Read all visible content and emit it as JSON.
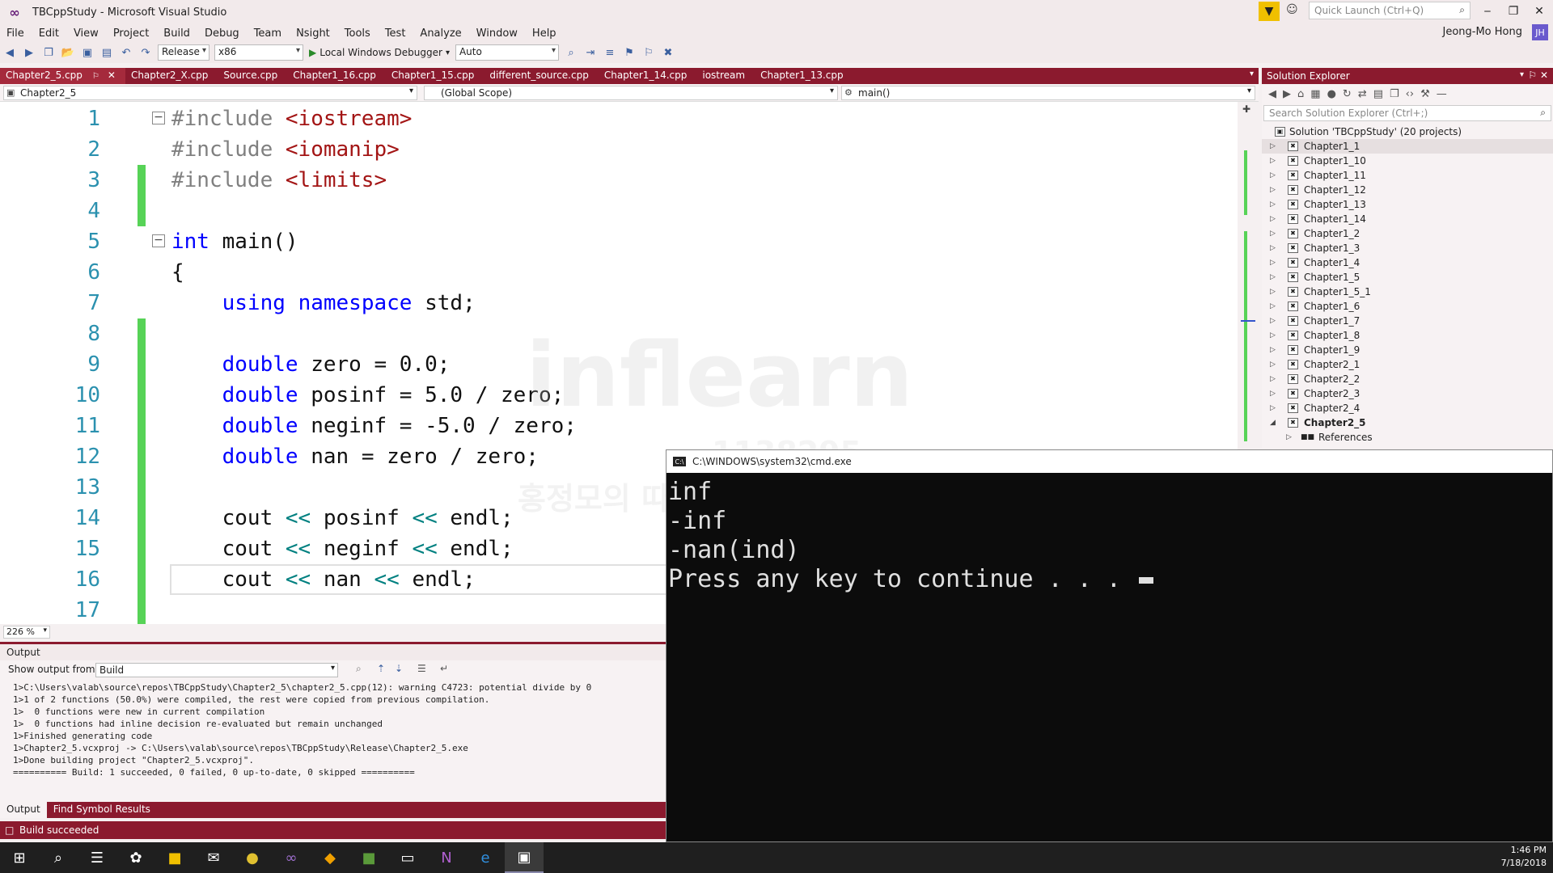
{
  "window": {
    "title": "TBCppStudy - Microsoft Visual Studio",
    "quick_launch_placeholder": "Quick Launch (Ctrl+Q)",
    "user_name": "Jeong-Mo Hong",
    "user_initials": "JH"
  },
  "menu": [
    "File",
    "Edit",
    "View",
    "Project",
    "Build",
    "Debug",
    "Team",
    "Nsight",
    "Tools",
    "Test",
    "Analyze",
    "Window",
    "Help"
  ],
  "toolbar": {
    "configuration": "Release",
    "platform": "x86",
    "debugger_label": "Local Windows Debugger",
    "solution_config": "Auto"
  },
  "doc_tabs": [
    {
      "label": "Chapter2_5.cpp",
      "active": true
    },
    {
      "label": "Chapter2_X.cpp"
    },
    {
      "label": "Source.cpp"
    },
    {
      "label": "Chapter1_16.cpp"
    },
    {
      "label": "Chapter1_15.cpp"
    },
    {
      "label": "different_source.cpp"
    },
    {
      "label": "Chapter1_14.cpp"
    },
    {
      "label": "iostream"
    },
    {
      "label": "Chapter1_13.cpp"
    }
  ],
  "nav": {
    "project": "Chapter2_5",
    "scope": "(Global Scope)",
    "member": "main()"
  },
  "code_lines": [
    {
      "n": "1",
      "text": "#include <iostream>"
    },
    {
      "n": "2",
      "text": "#include <iomanip>"
    },
    {
      "n": "3",
      "text": "#include <limits>"
    },
    {
      "n": "4",
      "text": ""
    },
    {
      "n": "5",
      "text": "int main()"
    },
    {
      "n": "6",
      "text": "{"
    },
    {
      "n": "7",
      "text": "    using namespace std;"
    },
    {
      "n": "8",
      "text": ""
    },
    {
      "n": "9",
      "text": "    double zero = 0.0;"
    },
    {
      "n": "10",
      "text": "    double posinf = 5.0 / zero;"
    },
    {
      "n": "11",
      "text": "    double neginf = -5.0 / zero;"
    },
    {
      "n": "12",
      "text": "    double nan = zero / zero;"
    },
    {
      "n": "13",
      "text": ""
    },
    {
      "n": "14",
      "text": "    cout << posinf << endl;"
    },
    {
      "n": "15",
      "text": "    cout << neginf << endl;"
    },
    {
      "n": "16",
      "text": "    cout << nan << endl;"
    },
    {
      "n": "17",
      "text": ""
    }
  ],
  "zoom": "226 %",
  "output": {
    "title": "Output",
    "show_from_label": "Show output from:",
    "source": "Build",
    "lines": [
      "1>C:\\Users\\valab\\source\\repos\\TBCppStudy\\Chapter2_5\\chapter2_5.cpp(12): warning C4723: potential divide by 0",
      "1>1 of 2 functions (50.0%) were compiled, the rest were copied from previous compilation.",
      "1>  0 functions were new in current compilation",
      "1>  0 functions had inline decision re-evaluated but remain unchanged",
      "1>Finished generating code",
      "1>Chapter2_5.vcxproj -> C:\\Users\\valab\\source\\repos\\TBCppStudy\\Release\\Chapter2_5.exe",
      "1>Done building project \"Chapter2_5.vcxproj\".",
      "========== Build: 1 succeeded, 0 failed, 0 up-to-date, 0 skipped =========="
    ]
  },
  "bottom_tabs": [
    "Output",
    "Find Symbol Results"
  ],
  "status": "Build succeeded",
  "solution_explorer": {
    "title": "Solution Explorer",
    "search_placeholder": "Search Solution Explorer (Ctrl+;)",
    "solution_label": "Solution 'TBCppStudy' (20 projects)",
    "projects": [
      "Chapter1_1",
      "Chapter1_10",
      "Chapter1_11",
      "Chapter1_12",
      "Chapter1_13",
      "Chapter1_14",
      "Chapter1_2",
      "Chapter1_3",
      "Chapter1_4",
      "Chapter1_5",
      "Chapter1_5_1",
      "Chapter1_6",
      "Chapter1_7",
      "Chapter1_8",
      "Chapter1_9",
      "Chapter2_1",
      "Chapter2_2",
      "Chapter2_3",
      "Chapter2_4",
      "Chapter2_5"
    ],
    "child": "References"
  },
  "console": {
    "title": "C:\\WINDOWS\\system32\\cmd.exe",
    "lines": [
      "inf",
      "-inf",
      "-nan(ind)",
      "Press any key to continue . . . "
    ]
  },
  "watermark": {
    "brand": "inflearn",
    "course": "홍정모의 따라하며 배우는 C++",
    "number": "1138295",
    "author": "홍정모"
  },
  "clock": {
    "time": "1:46 PM",
    "date": "7/18/2018"
  },
  "colors": {
    "accent": "#8b1a2e",
    "line_changed": "#57d357",
    "keyword": "#0000ff",
    "line_number": "#2b91af"
  }
}
